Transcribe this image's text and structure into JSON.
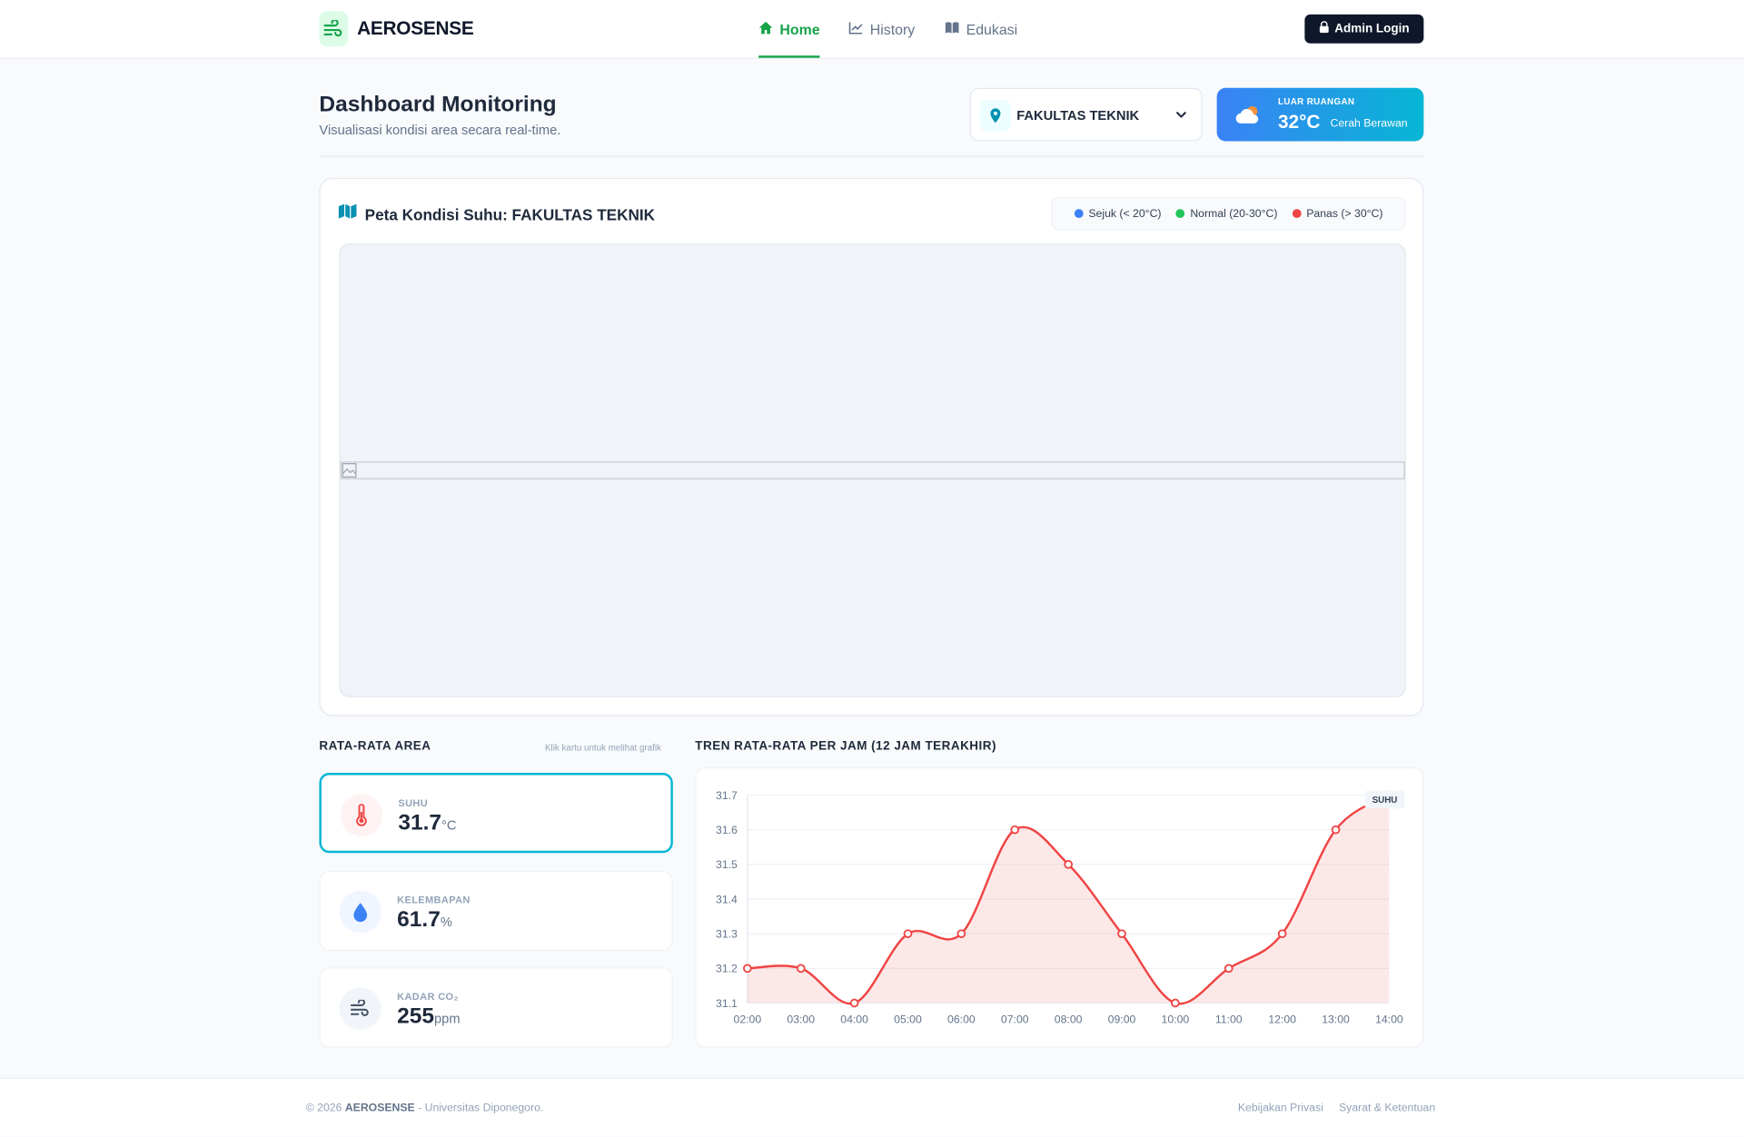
{
  "brand": {
    "name": "AEROSENSE"
  },
  "nav": {
    "items": [
      {
        "label": "Home",
        "icon": "home-icon",
        "active": true
      },
      {
        "label": "History",
        "icon": "chart-line-icon",
        "active": false
      },
      {
        "label": "Edukasi",
        "icon": "book-icon",
        "active": false
      }
    ],
    "admin_label": "Admin Login"
  },
  "header": {
    "title": "Dashboard Monitoring",
    "subtitle": "Visualisasi kondisi area secara real-time.",
    "location": "FAKULTAS TEKNIK",
    "weather": {
      "caption": "LUAR RUANGAN",
      "temp": "32°C",
      "desc": "Cerah Berawan"
    }
  },
  "map": {
    "title": "Peta Kondisi Suhu: FAKULTAS TEKNIK",
    "legend": [
      {
        "label": "Sejuk (< 20°C)",
        "color": "#3b82f6"
      },
      {
        "label": "Normal (20-30°C)",
        "color": "#22c55e"
      },
      {
        "label": "Panas (> 30°C)",
        "color": "#ef4444"
      }
    ]
  },
  "averages": {
    "title": "RATA-RATA AREA",
    "hint": "Klik kartu untuk melihat grafik",
    "cards": [
      {
        "label": "SUHU",
        "value": "31.7",
        "unit": "°C",
        "icon": "thermometer-icon",
        "color": "#ef4444",
        "selected": true
      },
      {
        "label": "KELEMBAPAN",
        "value": "61.7",
        "unit": "%",
        "icon": "droplet-icon",
        "color": "#3b82f6",
        "selected": false
      },
      {
        "label": "KADAR CO₂",
        "value": "255",
        "unit": "ppm",
        "icon": "wind-icon",
        "color": "#475569",
        "selected": false
      }
    ]
  },
  "trend": {
    "title": "TREN RATA-RATA PER JAM (12 JAM TERAKHIR)",
    "badge": "SUHU"
  },
  "chart_data": {
    "type": "line",
    "x": [
      "02:00",
      "03:00",
      "04:00",
      "05:00",
      "06:00",
      "07:00",
      "08:00",
      "09:00",
      "10:00",
      "11:00",
      "12:00",
      "13:00",
      "14:00"
    ],
    "series": [
      {
        "name": "SUHU",
        "values": [
          31.2,
          31.2,
          31.1,
          31.3,
          31.3,
          31.6,
          31.5,
          31.3,
          31.1,
          31.2,
          31.3,
          31.6,
          31.7
        ],
        "color": "#ef4444"
      }
    ],
    "y_ticks": [
      31.1,
      31.2,
      31.3,
      31.4,
      31.5,
      31.6,
      31.7
    ],
    "ylim": [
      31.1,
      31.7
    ],
    "grid": true,
    "fill": true
  },
  "footer": {
    "copyright_prefix": "© 2026",
    "brand": "AEROSENSE",
    "copyright_suffix": "- Universitas Diponegoro.",
    "links": [
      "Kebijakan Privasi",
      "Syarat & Ketentuan"
    ]
  }
}
